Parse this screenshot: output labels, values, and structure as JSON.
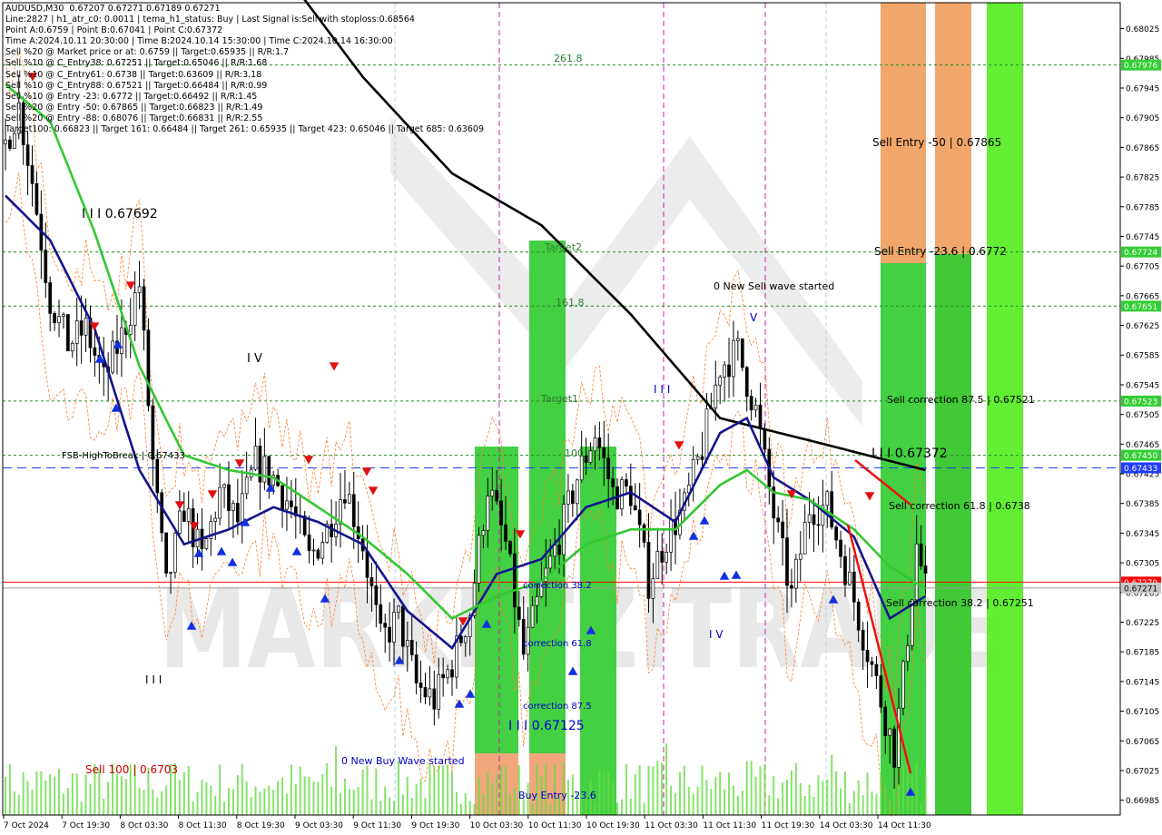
{
  "info_lines": [
    "AUDUSD,M30  0.67207 0.67271 0.67189 0.67271",
    "Line:2827 | h1_atr_c0: 0.0011 | tema_h1_status: Buy | Last Signal is:Sell with stoploss:0.68564",
    "Point A:0.6759 | Point B:0.67041 | Point C:0.67372",
    "Time A:2024.10.11 20:30:00 | Time B:2024.10.14 15:30:00 | Time C:2024.10.14 16:30:00",
    "Sell %20 @ Market price or at: 0.6759 || Target:0.65935 || R/R:1.7",
    "Sell %10 @ C_Entry38: 0.67251 || Target:0.65046 || R/R:1.68",
    "Sell %10 @ C_Entry61: 0.6738 || Target:0.63609 || R/R:3.18",
    "Sell %10 @ C_Entry88: 0.67521 || Target:0.66484 || R/R:0.99",
    "Sell %10 @ Entry -23: 0.6772 || Target:0.66492 || R/R:1.45",
    "Sell %20 @ Entry -50: 0.67865 || Target:0.66823 || R/R:1.49",
    "Sell %20 @ Entry -88: 0.68076 || Target:0.66831 || R/R:2.55",
    "Target100: 0.66823 || Target 161: 0.66484 || Target 261: 0.65935 || Target 423: 0.65046 || Target 685: 0.63609"
  ],
  "annotations": [
    {
      "text": "261.8",
      "color": "#2e7d32"
    },
    {
      "text": "Target2",
      "color": "#2e7d32"
    },
    {
      "text": "161.8",
      "color": "#2e7d32"
    },
    {
      "text": "Target1",
      "color": "#2e7d32"
    },
    {
      "text": "100",
      "color": "#2e7d32"
    },
    {
      "text": "0 New Sell wave started",
      "color": "#000000"
    },
    {
      "text": "V",
      "color": "#0000cc"
    },
    {
      "text": "I I I",
      "color": "#0000cc"
    },
    {
      "text": "I I I 0.67692",
      "color": "#000000"
    },
    {
      "text": "I V",
      "color": "#000000"
    },
    {
      "text": "FSB-HighToBreak | 0.67433",
      "color": "#000000"
    },
    {
      "text": "I I I",
      "color": "#000000"
    },
    {
      "text": "Sell 100 | 0.6703",
      "color": "#cc0000"
    },
    {
      "text": "0 New Buy Wave started",
      "color": "#0000cc"
    },
    {
      "text": "correction 38.2",
      "color": "#0000cc"
    },
    {
      "text": "correction 61.8",
      "color": "#0000cc"
    },
    {
      "text": "correction 87.5",
      "color": "#0000cc"
    },
    {
      "text": "I I I 0.67125",
      "color": "#0000cc"
    },
    {
      "text": "Buy Entry -23.6",
      "color": "#0000cc"
    },
    {
      "text": "I V",
      "color": "#0000cc"
    },
    {
      "text": "Sell Entry -50 | 0.67865",
      "color": "#000000"
    },
    {
      "text": "Sell Entry -23.6 | 0.6772",
      "color": "#000000"
    },
    {
      "text": "Sell correction 87.5 | 0.67521",
      "color": "#000000"
    },
    {
      "text": "I I I 0.67372",
      "color": "#000000"
    },
    {
      "text": "Sell correction 61.8 | 0.6738",
      "color": "#000000"
    },
    {
      "text": "Sell correction 38.2 | 0.67251",
      "color": "#000000"
    }
  ],
  "chart_data": {
    "type": "candlestick",
    "symbol": "AUDUSD",
    "timeframe": "M30",
    "x_tick_labels": [
      "7 Oct 2024",
      "7 Oct 19:30",
      "8 Oct 03:30",
      "8 Oct 11:30",
      "8 Oct 19:30",
      "9 Oct 03:30",
      "9 Oct 11:30",
      "9 Oct 19:30",
      "10 Oct 03:30",
      "10 Oct 11:30",
      "10 Oct 19:30",
      "11 Oct 03:30",
      "11 Oct 11:30",
      "11 Oct 19:30",
      "14 Oct 03:30",
      "14 Oct 11:30"
    ],
    "y_tick_labels": [
      "0.68025",
      "0.67985",
      "0.67945",
      "0.67905",
      "0.67865",
      "0.67825",
      "0.67785",
      "0.67745",
      "0.67705",
      "0.67665",
      "0.67625",
      "0.67585",
      "0.67545",
      "0.67505",
      "0.67465",
      "0.67425",
      "0.67385",
      "0.67345",
      "0.67305",
      "0.67265",
      "0.67225",
      "0.67185",
      "0.67145",
      "0.67105",
      "0.67065",
      "0.67025",
      "0.66985"
    ],
    "ylim": [
      0.66965,
      0.6806
    ],
    "close_path": [
      [
        0,
        0.6787
      ],
      [
        3,
        0.6792
      ],
      [
        6,
        0.6782
      ],
      [
        10,
        0.6766
      ],
      [
        14,
        0.676
      ],
      [
        18,
        0.6762
      ],
      [
        22,
        0.6755
      ],
      [
        26,
        0.6761
      ],
      [
        30,
        0.6768
      ],
      [
        33,
        0.6744
      ],
      [
        36,
        0.6727
      ],
      [
        40,
        0.6738
      ],
      [
        44,
        0.6731
      ],
      [
        48,
        0.674
      ],
      [
        52,
        0.6736
      ],
      [
        56,
        0.6744
      ],
      [
        60,
        0.6742
      ],
      [
        64,
        0.6738
      ],
      [
        68,
        0.6731
      ],
      [
        72,
        0.6735
      ],
      [
        76,
        0.6741
      ],
      [
        80,
        0.6733
      ],
      [
        84,
        0.672
      ],
      [
        88,
        0.6723
      ],
      [
        92,
        0.6714
      ],
      [
        96,
        0.6712
      ],
      [
        100,
        0.6717
      ],
      [
        104,
        0.6724
      ],
      [
        108,
        0.6741
      ],
      [
        112,
        0.6733
      ],
      [
        116,
        0.6718
      ],
      [
        120,
        0.6727
      ],
      [
        124,
        0.6734
      ],
      [
        128,
        0.6742
      ],
      [
        132,
        0.6748
      ],
      [
        136,
        0.674
      ],
      [
        140,
        0.674
      ],
      [
        144,
        0.6728
      ],
      [
        148,
        0.6734
      ],
      [
        152,
        0.6738
      ],
      [
        156,
        0.6746
      ],
      [
        160,
        0.6757
      ],
      [
        164,
        0.6759
      ],
      [
        168,
        0.6751
      ],
      [
        172,
        0.6737
      ],
      [
        176,
        0.6726
      ],
      [
        180,
        0.6738
      ],
      [
        184,
        0.6738
      ],
      [
        188,
        0.673
      ],
      [
        192,
        0.6721
      ],
      [
        196,
        0.6712
      ],
      [
        199,
        0.6705
      ],
      [
        201,
        0.6715
      ],
      [
        204,
        0.6733
      ],
      [
        206,
        0.6727
      ]
    ],
    "series": [
      {
        "name": "",
        "color": "#000000",
        "values": [
          [
            60,
            0.6812
          ],
          [
            80,
            0.6796
          ],
          [
            100,
            0.6783
          ],
          [
            120,
            0.6776
          ],
          [
            140,
            0.6764
          ],
          [
            160,
            0.675
          ],
          [
            180,
            0.6747
          ],
          [
            206,
            0.6743
          ]
        ]
      },
      {
        "name": "",
        "color": "#14148c",
        "values": [
          [
            0,
            0.678
          ],
          [
            10,
            0.6774
          ],
          [
            20,
            0.6762
          ],
          [
            30,
            0.6743
          ],
          [
            40,
            0.6733
          ],
          [
            50,
            0.6735
          ],
          [
            60,
            0.6738
          ],
          [
            70,
            0.6736
          ],
          [
            80,
            0.6733
          ],
          [
            90,
            0.6724
          ],
          [
            100,
            0.6719
          ],
          [
            110,
            0.6729
          ],
          [
            120,
            0.6731
          ],
          [
            130,
            0.6738
          ],
          [
            140,
            0.674
          ],
          [
            150,
            0.6736
          ],
          [
            160,
            0.6748
          ],
          [
            166,
            0.675
          ],
          [
            172,
            0.6742
          ],
          [
            180,
            0.6739
          ],
          [
            190,
            0.6734
          ],
          [
            198,
            0.6723
          ],
          [
            206,
            0.6726
          ]
        ]
      },
      {
        "name": "",
        "color": "#32c832",
        "values": [
          [
            0,
            0.6795
          ],
          [
            10,
            0.679
          ],
          [
            20,
            0.6775
          ],
          [
            30,
            0.6757
          ],
          [
            40,
            0.6745
          ],
          [
            50,
            0.6743
          ],
          [
            60,
            0.6742
          ],
          [
            70,
            0.6738
          ],
          [
            80,
            0.6734
          ],
          [
            90,
            0.6729
          ],
          [
            100,
            0.6723
          ],
          [
            110,
            0.6726
          ],
          [
            120,
            0.6728
          ],
          [
            130,
            0.6733
          ],
          [
            140,
            0.6735
          ],
          [
            150,
            0.6735
          ],
          [
            160,
            0.6741
          ],
          [
            166,
            0.6743
          ],
          [
            172,
            0.674
          ],
          [
            180,
            0.6739
          ],
          [
            190,
            0.6735
          ],
          [
            198,
            0.673
          ],
          [
            206,
            0.6727
          ]
        ]
      }
    ],
    "horizontal_levels": [
      0.67976,
      0.67724,
      0.67651,
      0.67523,
      0.6745,
      0.67433,
      0.67279,
      0.67271
    ],
    "price_labels": [
      {
        "text": "0.67976",
        "value": 0.67976,
        "bg": "#32cd32"
      },
      {
        "text": "0.67724",
        "value": 0.67724,
        "bg": "#32cd32"
      },
      {
        "text": "0.67651",
        "value": 0.67651,
        "bg": "#32cd32"
      },
      {
        "text": "0.67523",
        "value": 0.67523,
        "bg": "#32cd32"
      },
      {
        "text": "0.67450",
        "value": 0.6745,
        "bg": "#32cd32"
      },
      {
        "text": "0.67433",
        "value": 0.67433,
        "bg": "#1e3cff"
      },
      {
        "text": "0.67279",
        "value": 0.67279,
        "bg": "#ff0000"
      },
      {
        "text": "0.67271",
        "value": 0.67271,
        "bg": "#c8c8c8"
      }
    ],
    "grid": false,
    "background": "#ffffff",
    "watermark": "MARKETZITRADE"
  }
}
